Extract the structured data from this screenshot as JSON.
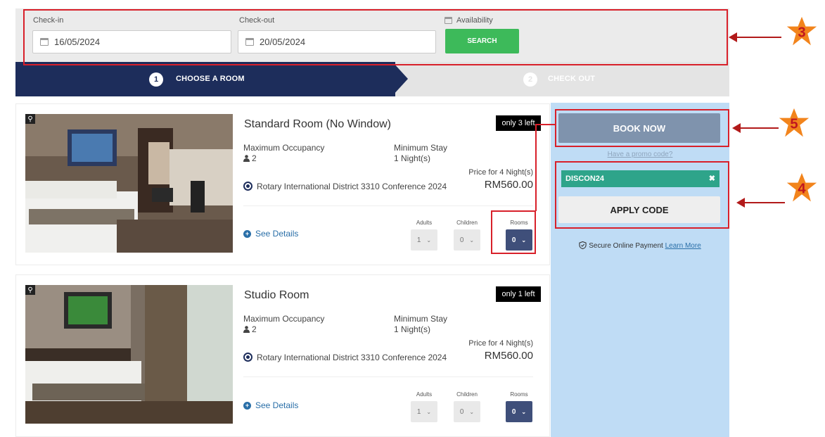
{
  "search": {
    "checkin_label": "Check-in",
    "checkin_value": "16/05/2024",
    "checkout_label": "Check-out",
    "checkout_value": "20/05/2024",
    "availability_label": "Availability",
    "search_button": "SEARCH"
  },
  "steps": [
    {
      "number": "1",
      "label": "CHOOSE A ROOM",
      "active": true
    },
    {
      "number": "2",
      "label": "CHECK OUT",
      "active": false
    }
  ],
  "rooms": [
    {
      "name": "Standard Room (No Window)",
      "availability": "only 3 left",
      "max_occupancy_label": "Maximum Occupancy",
      "occupancy": "2",
      "min_stay_label": "Minimum Stay",
      "min_stay": "1 Night(s)",
      "rate_name": "Rotary International District 3310 Conference 2024",
      "price_label": "Price for 4 Night(s)",
      "price": "RM560.00",
      "see_details": "See Details",
      "adults_label": "Adults",
      "adults_value": "1",
      "children_label": "Children",
      "children_value": "0",
      "rooms_label": "Rooms",
      "rooms_value": "0"
    },
    {
      "name": "Studio Room",
      "availability": "only 1 left",
      "max_occupancy_label": "Maximum Occupancy",
      "occupancy": "2",
      "min_stay_label": "Minimum Stay",
      "min_stay": "1 Night(s)",
      "rate_name": "Rotary International District 3310 Conference 2024",
      "price_label": "Price for 4 Night(s)",
      "price": "RM560.00",
      "see_details": "See Details",
      "adults_label": "Adults",
      "adults_value": "1",
      "children_label": "Children",
      "children_value": "0",
      "rooms_label": "Rooms",
      "rooms_value": "0"
    }
  ],
  "sidebar": {
    "book_now": "BOOK NOW",
    "promo_link": "Have a promo code?",
    "promo_code": "DISCON24",
    "clear_icon": "✖",
    "apply_code": "APPLY CODE",
    "secure_text": "Secure Online Payment",
    "learn_more": "Learn More"
  },
  "annotations": {
    "callout_3": "3",
    "callout_4": "4",
    "callout_5": "5"
  },
  "icons": {
    "calendar": "calendar-icon",
    "zoom": "zoom-icon",
    "person": "person-icon",
    "shield": "shield-check-icon",
    "plus_circle": "plus-circle-icon",
    "chevron": "chevron-down-icon"
  },
  "colors": {
    "primary_navy": "#1d2d5b",
    "search_green": "#3dba5a",
    "sidebar_blue": "#bfdcf5",
    "promo_teal": "#2ea48a",
    "annotation_red": "#d8202a",
    "callout_orange": "#f2841c"
  }
}
